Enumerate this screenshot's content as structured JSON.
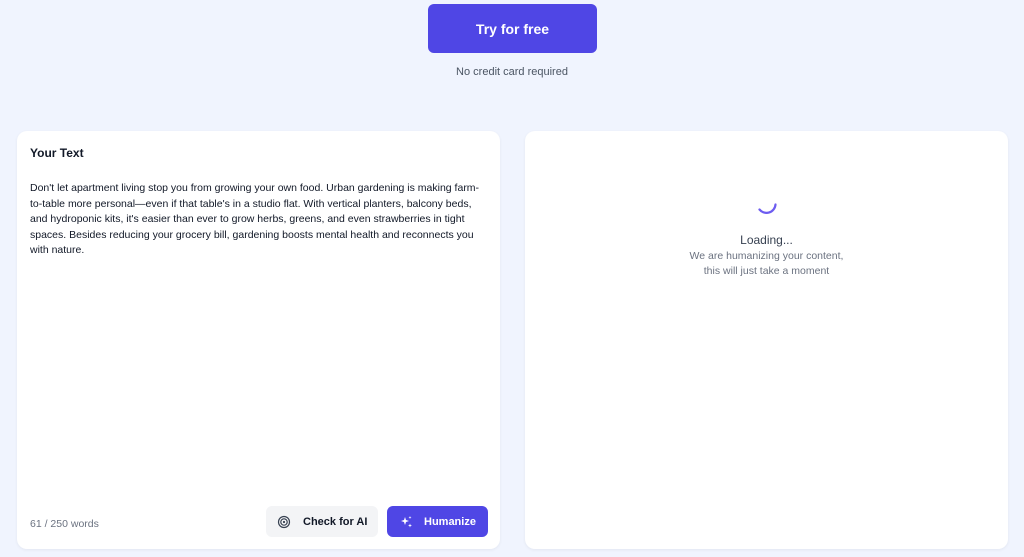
{
  "cta": {
    "button_label": "Try for free",
    "note": "No credit card required"
  },
  "editor": {
    "title": "Your Text",
    "content": "Don't let apartment living stop you from growing your own food. Urban gardening is making farm-to-table more personal—even if that table's in a studio flat. With vertical planters, balcony beds, and hydroponic kits, it's easier than ever to grow herbs, greens, and even strawberries in tight spaces. Besides reducing your grocery bill, gardening boosts mental health and reconnects you with nature.",
    "word_count": "61 / 250 words",
    "check_button_label": "Check for AI",
    "check_icon": "target-icon",
    "humanize_button_label": "Humanize",
    "humanize_icon": "sparkles-icon"
  },
  "output": {
    "loading_title": "Loading...",
    "loading_line_1": "We are humanizing your content,",
    "loading_line_2": "this will just take a moment"
  },
  "colors": {
    "accent": "#4f46e5",
    "background": "#f0f4fe",
    "card": "#ffffff"
  }
}
